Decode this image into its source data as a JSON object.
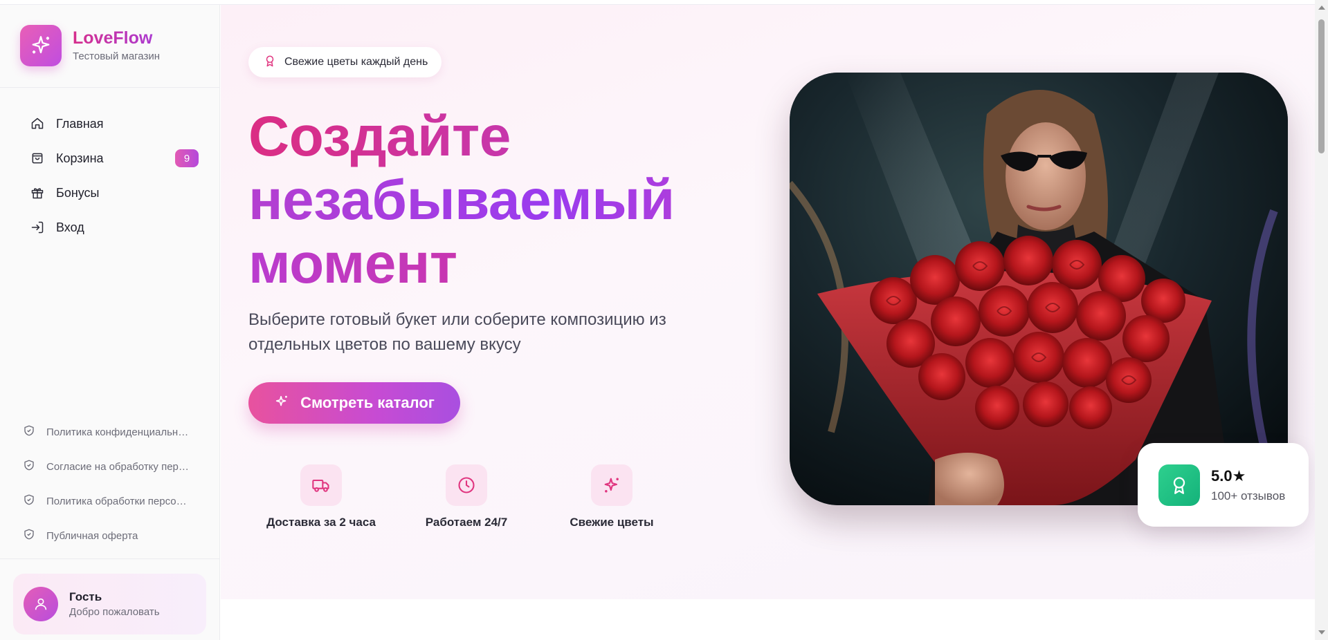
{
  "brand": {
    "title": "LoveFlow",
    "subtitle": "Тестовый магазин",
    "logo_icon": "sparkles-icon"
  },
  "nav": {
    "items": [
      {
        "label": "Главная",
        "icon": "home-icon"
      },
      {
        "label": "Корзина",
        "icon": "shopping-bag-icon",
        "badge": "9"
      },
      {
        "label": "Бонусы",
        "icon": "gift-icon"
      },
      {
        "label": "Вход",
        "icon": "login-icon"
      }
    ]
  },
  "legal": {
    "items": [
      {
        "label": "Политика конфиденциальности",
        "icon": "shield-check-icon"
      },
      {
        "label": "Согласие на обработку персональных данных",
        "icon": "shield-check-icon"
      },
      {
        "label": "Политика обработки персональных данных",
        "icon": "shield-check-icon"
      },
      {
        "label": "Публичная оферта",
        "icon": "shield-check-icon"
      }
    ]
  },
  "guest": {
    "name": "Гость",
    "subtitle": "Добро пожаловать",
    "icon": "user-icon"
  },
  "hero": {
    "pill_label": "Свежие цветы каждый день",
    "pill_icon": "award-icon",
    "headline_line1": "Создайте",
    "headline_line2": "незабываемый",
    "headline_line3": "момент",
    "lead": "Выберите готовый букет или соберите композицию из отдельных цветов по вашему вкусу",
    "cta_label": "Смотреть каталог",
    "cta_icon": "sparkles-icon",
    "features": [
      {
        "label": "Доставка за 2 часа",
        "icon": "truck-icon"
      },
      {
        "label": "Работаем 24/7",
        "icon": "clock-icon"
      },
      {
        "label": "Свежие цветы",
        "icon": "sparkles-icon"
      }
    ],
    "image_alt_subject": "woman-with-red-roses-bouquet"
  },
  "rating": {
    "value": "5.0★",
    "subtitle": "100+ отзывов",
    "icon": "award-icon"
  },
  "colors": {
    "accent_pink": "#e8529e",
    "accent_purple": "#a94fe0",
    "badge_green": "#2ed08e",
    "feature_bg": "#fbe3f1"
  }
}
